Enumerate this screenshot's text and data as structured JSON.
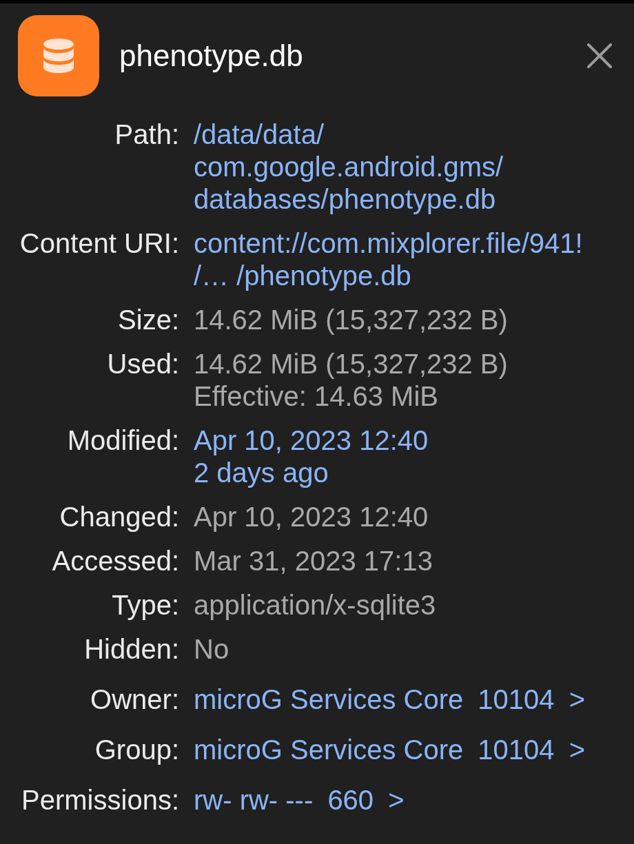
{
  "header": {
    "title": "phenotype.db"
  },
  "properties": [
    {
      "label": "Path:",
      "kind": "link",
      "lines": [
        "/data/data/",
        "com.google.android.gms/",
        "databases/phenotype.db"
      ]
    },
    {
      "label": "Content URI:",
      "kind": "link",
      "lines": [
        "content://com.mixplorer.file/941!",
        "/… /phenotype.db"
      ]
    },
    {
      "label": "Size:",
      "kind": "plain",
      "lines": [
        "14.62 MiB (15,327,232 B)"
      ]
    },
    {
      "label": "Used:",
      "kind": "plain",
      "lines": [
        "14.62 MiB (15,327,232 B)",
        "Effective: 14.63 MiB"
      ]
    },
    {
      "label": "Modified:",
      "kind": "link",
      "lines": [
        "Apr 10, 2023 12:40",
        "2 days ago"
      ]
    },
    {
      "label": "Changed:",
      "kind": "plain",
      "lines": [
        "Apr 10, 2023 12:40"
      ]
    },
    {
      "label": "Accessed:",
      "kind": "plain",
      "lines": [
        "Mar 31, 2023 17:13"
      ]
    },
    {
      "label": "Type:",
      "kind": "plain",
      "lines": [
        "application/x-sqlite3"
      ]
    },
    {
      "label": "Hidden:",
      "kind": "plain",
      "lines": [
        "No"
      ]
    },
    {
      "label": "Owner:",
      "kind": "nav",
      "parts": [
        "microG Services Core",
        "10104",
        ">"
      ]
    },
    {
      "label": "Group:",
      "kind": "nav",
      "parts": [
        "microG Services Core",
        "10104",
        ">"
      ]
    },
    {
      "label": "Permissions:",
      "kind": "nav",
      "parts": [
        "rw- rw- ---",
        "660",
        ">"
      ]
    }
  ]
}
